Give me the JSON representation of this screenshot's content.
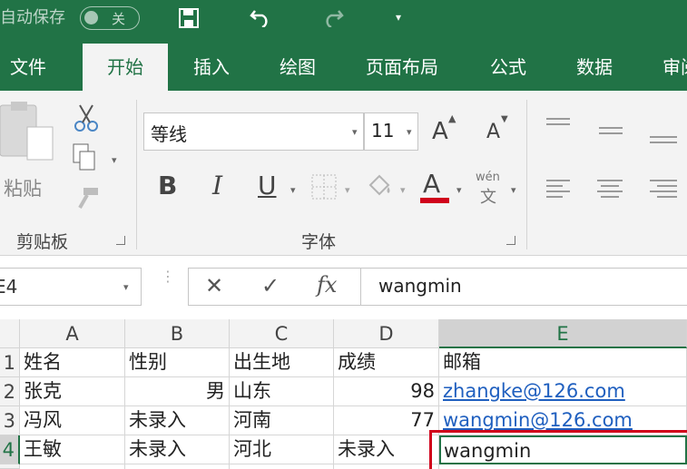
{
  "colors": {
    "brand": "#217346",
    "selection": "#d0021b",
    "link": "#1f5fbf"
  },
  "quick_access": {
    "autosave_label": "自动保存",
    "toggle_state": "关",
    "icons": [
      "save-icon",
      "undo-icon",
      "redo-icon",
      "customize-icon"
    ]
  },
  "tabs": [
    {
      "label": "文件",
      "active": false
    },
    {
      "label": "开始",
      "active": true
    },
    {
      "label": "插入",
      "active": false
    },
    {
      "label": "绘图",
      "active": false
    },
    {
      "label": "页面布局",
      "active": false
    },
    {
      "label": "公式",
      "active": false
    },
    {
      "label": "数据",
      "active": false
    },
    {
      "label": "审阅",
      "active": false
    }
  ],
  "ribbon": {
    "clipboard": {
      "paste_label": "粘贴",
      "group_label": "剪贴板"
    },
    "font": {
      "font_name": "等线",
      "font_size": "11",
      "bold": "B",
      "italic": "I",
      "underline": "U",
      "font_color_glyph": "A",
      "phonetic_top": "wén",
      "phonetic_bottom": "文",
      "grow_glyph": "A",
      "shrink_glyph": "A",
      "group_label": "字体"
    }
  },
  "formula_bar": {
    "name_box": "E4",
    "cancel_glyph": "✕",
    "enter_glyph": "✓",
    "fx_glyph": "fx",
    "content": "wangmin"
  },
  "sheet": {
    "columns": [
      "A",
      "B",
      "C",
      "D",
      "E"
    ],
    "selected_column": "E",
    "rows": [
      {
        "num": "1",
        "a": "姓名",
        "b": "性别",
        "c": "出生地",
        "d": "成绩",
        "e": "邮箱"
      },
      {
        "num": "2",
        "a": "张克",
        "b": "男",
        "c": "山东",
        "d": "98",
        "e": "zhangke@126.com"
      },
      {
        "num": "3",
        "a": "冯风",
        "b": "未录入",
        "c": "河南",
        "d": "77",
        "e": "wangmin@126.com"
      },
      {
        "num": "4",
        "a": "王敏",
        "b": "未录入",
        "c": "河北",
        "d": "未录入",
        "e": "wangmin"
      }
    ]
  }
}
